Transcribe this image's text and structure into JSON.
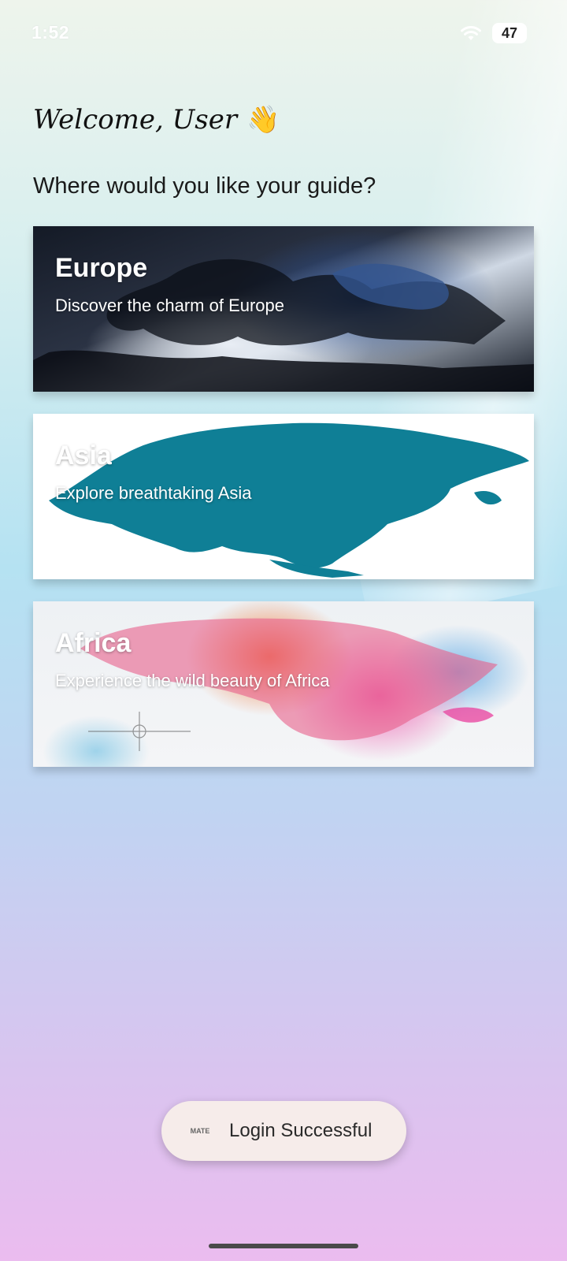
{
  "status_bar": {
    "time": "1:52",
    "battery": "47"
  },
  "header": {
    "welcome": "Welcome, User",
    "wave_emoji": "👋",
    "subtitle": "Where would you like your guide?"
  },
  "cards": [
    {
      "title": "Europe",
      "description": "Discover the charm of Europe",
      "map_image": "europe-map"
    },
    {
      "title": "Asia",
      "description": "Explore breathtaking Asia",
      "map_image": "asia-map"
    },
    {
      "title": "Africa",
      "description": "Experience the wild beauty of Africa",
      "map_image": "africa-map"
    }
  ],
  "toast": {
    "logo": "MATE",
    "message": "Login Successful"
  },
  "colors": {
    "asia_map": "#0f7f96",
    "card_text": "#ffffff",
    "toast_bg": "#f6ecea"
  }
}
